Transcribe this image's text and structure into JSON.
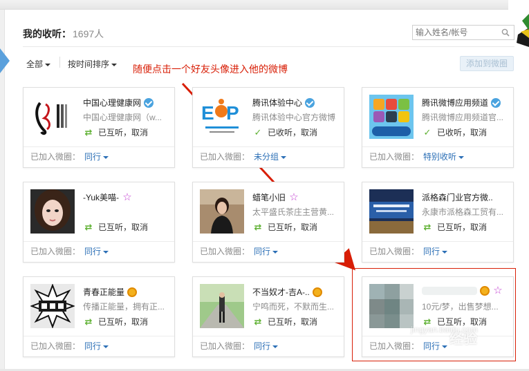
{
  "page": {
    "title": "我的收听：",
    "follow_count": "1697人",
    "search_placeholder": "输入姓名/帐号"
  },
  "filters": {
    "all_label": "全部",
    "sort_label": "按时间排序"
  },
  "annotation": "随便点击一个好友头像进入他的微博",
  "add_to_circle_label": "添加到微圈",
  "footer_prefix": "已加入微圈：",
  "cancel_label": "取消",
  "cards": [
    {
      "name": "中国心理健康网",
      "badge": "verified",
      "desc": "中国心理健康网（w...",
      "status": "已互听，",
      "status_icon": "mutual-follow-icon",
      "group": "同行"
    },
    {
      "name": "腾讯体验中心",
      "badge": "verified",
      "desc": "腾讯体验中心官方微博",
      "status": "已收听，",
      "status_icon": "check-icon",
      "group": "未分组"
    },
    {
      "name": "腾讯微博应用频道",
      "badge": "verified",
      "desc": "腾讯微博应用频道官...",
      "status": "已收听，",
      "status_icon": "check-icon",
      "group": "特别收听"
    },
    {
      "name": "-Yuk美喵-",
      "badge": "star",
      "desc": "",
      "status": "已互听，",
      "status_icon": "mutual-follow-icon",
      "group": "同行"
    },
    {
      "name": "蜡笔小旧",
      "badge": "star",
      "desc": "太平盛氏茶庄主营黄...",
      "status": "已互听，",
      "status_icon": "mutual-follow-icon",
      "group": "同行"
    },
    {
      "name": "派格森门业官方微..",
      "badge": "",
      "desc": "永康市派格森工贸有...",
      "status": "已互听，",
      "status_icon": "mutual-follow-icon",
      "group": "同行"
    },
    {
      "name": "青春正能量",
      "badge": "vip",
      "desc": "传播正能量，拥有正...",
      "status": "已互听，",
      "status_icon": "mutual-follow-icon",
      "group": "同行"
    },
    {
      "name": "不当奴才-吉A-..",
      "badge": "vip",
      "desc": "宁鸣而死，不默而生...",
      "status": "已互听，",
      "status_icon": "mutual-follow-icon",
      "group": "同行"
    },
    {
      "name": "",
      "badge": "vip-star",
      "desc": "10元/梦，出售梦想...",
      "status": "已互听，",
      "status_icon": "mutual-follow-icon",
      "group": "同行"
    }
  ],
  "watermark": {
    "small": "jingyan.baidu.com",
    "big": "经验"
  },
  "colors": {
    "link": "#2b6fb6",
    "annotation": "#d81e06",
    "verified": "#4aa3df",
    "mutual": "#5fb133"
  }
}
